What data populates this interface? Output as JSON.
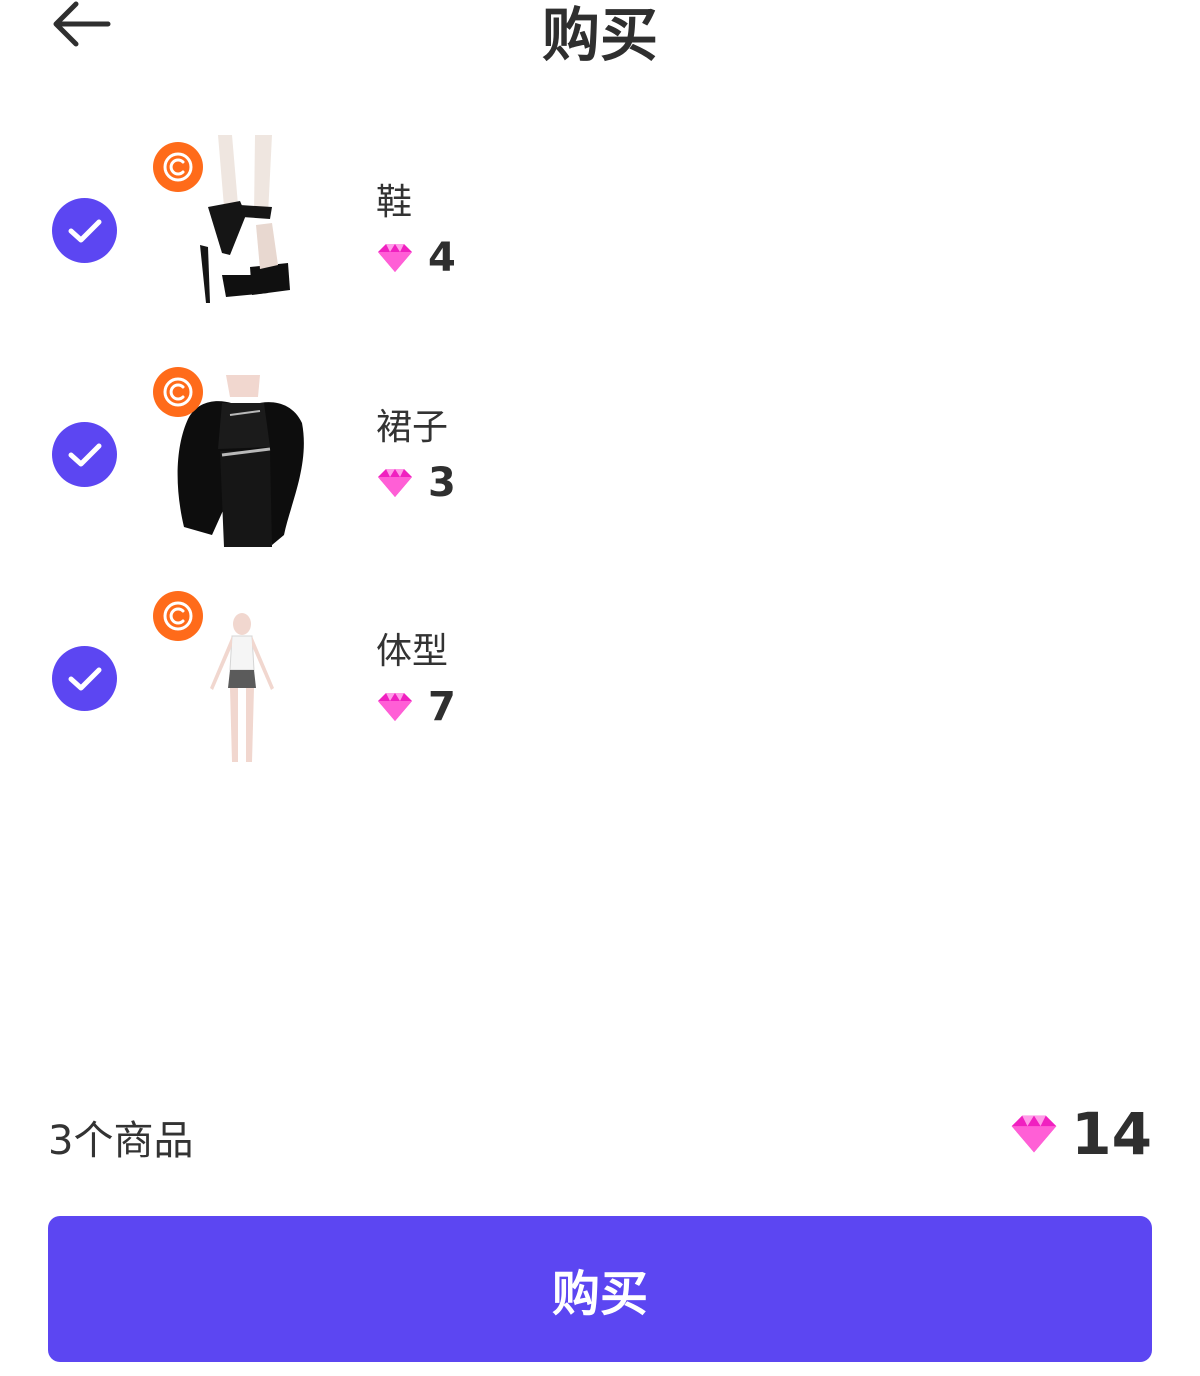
{
  "header": {
    "title": "购买",
    "back_icon": "arrow-left-icon"
  },
  "items": [
    {
      "name": "鞋",
      "price": "4",
      "icon": "shoes-thumbnail",
      "checked": true
    },
    {
      "name": "裙子",
      "price": "3",
      "icon": "dress-thumbnail",
      "checked": true
    },
    {
      "name": "体型",
      "price": "7",
      "icon": "body-type-thumbnail",
      "checked": true
    }
  ],
  "summary": {
    "count_label": "3个商品",
    "total": "14"
  },
  "buy_button": {
    "label": "购买"
  },
  "colors": {
    "accent": "#5C46F2",
    "badge": "#FF6B1A",
    "gem": "#F020C0",
    "text": "#2F2F2F"
  }
}
